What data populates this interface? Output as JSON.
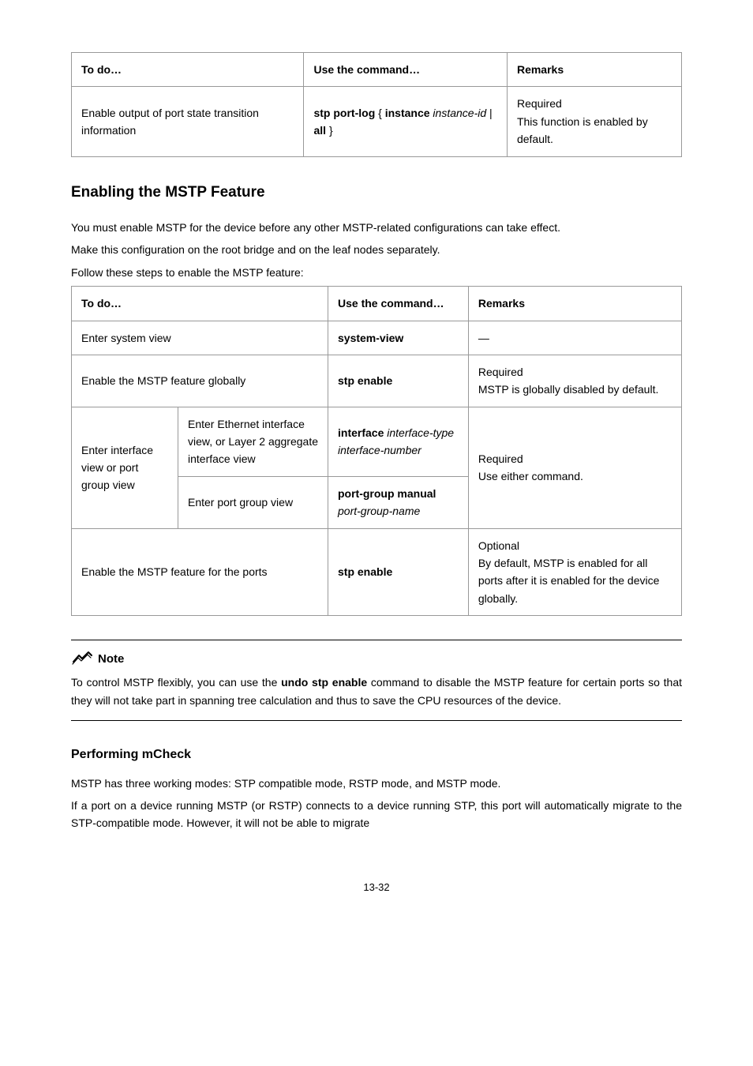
{
  "table1": {
    "headers": [
      "To do…",
      "Use the command…",
      "Remarks"
    ],
    "row": {
      "todo": "Enable output of port state transition information",
      "cmd_a": "stp port-log",
      "cmd_b": "instance",
      "cmd_c": "instance-id",
      "cmd_d": "all",
      "remarks_a": "Required",
      "remarks_b": "This function is enabled by default."
    }
  },
  "section1": {
    "title": "Enabling the MSTP Feature",
    "p1": "You must enable MSTP for the device before any other MSTP-related configurations can take effect.",
    "p2": "Make this configuration on the root bridge and on the leaf nodes separately.",
    "p3": "Follow these steps to enable the MSTP feature:"
  },
  "table2": {
    "headers": [
      "To do…",
      "Use the command…",
      "Remarks"
    ],
    "r1": {
      "todo": "Enter system view",
      "cmd": "system-view",
      "rem": "—"
    },
    "r2": {
      "todo": "Enable the MSTP feature globally",
      "cmd": "stp enable",
      "rem_a": "Required",
      "rem_b": "MSTP is globally disabled by default."
    },
    "r3": {
      "todo_a": "Enter interface view or port group view",
      "todo_b": "Enter Ethernet interface view, or Layer 2 aggregate interface view",
      "todo_c": "Enter port group view",
      "cmd_b1": "interface",
      "cmd_b2": "interface-type interface-number",
      "cmd_c1": "port-group manual",
      "cmd_c2": "port-group-name",
      "rem_a": "Required",
      "rem_b": "Use either command."
    },
    "r4": {
      "todo": "Enable the MSTP feature for the ports",
      "cmd": "stp enable",
      "rem_a": "Optional",
      "rem_b": "By default, MSTP is enabled for all ports after it is enabled for the device globally."
    }
  },
  "note": {
    "label": "Note",
    "body_a": "To control MSTP flexibly, you can use the ",
    "body_cmd": "undo stp enable",
    "body_b": " command to disable the MSTP feature for certain ports so that they will not take part in spanning tree calculation and thus to save the CPU resources of the device."
  },
  "section2": {
    "title": "Performing mCheck",
    "p1": "MSTP has three working modes: STP compatible mode, RSTP mode, and MSTP mode.",
    "p2": "If a port on a device running MSTP (or RSTP) connects to a device running STP, this port will automatically migrate to the STP-compatible mode. However, it will not be able to migrate"
  },
  "pagenum": "13-32"
}
